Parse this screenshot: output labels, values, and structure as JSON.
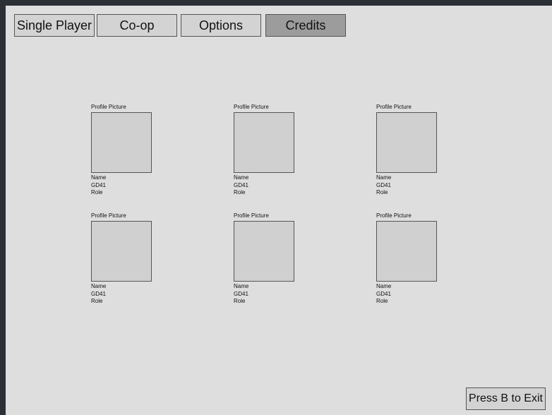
{
  "tabs": [
    {
      "label": "Single Player",
      "active": false
    },
    {
      "label": "Co-op",
      "active": false
    },
    {
      "label": "Options",
      "active": false
    },
    {
      "label": "Credits",
      "active": true
    }
  ],
  "credits": [
    {
      "caption": "Profile Picture",
      "name": "Name",
      "id": "GD41",
      "role": "Role"
    },
    {
      "caption": "Profile Picture",
      "name": "Name",
      "id": "GD41",
      "role": "Role"
    },
    {
      "caption": "Profile Picture",
      "name": "Name",
      "id": "GD41",
      "role": "Role"
    },
    {
      "caption": "Profile Picture",
      "name": "Name",
      "id": "GD41",
      "role": "Role"
    },
    {
      "caption": "Profile Picture",
      "name": "Name",
      "id": "GD41",
      "role": "Role"
    },
    {
      "caption": "Profile Picture",
      "name": "Name",
      "id": "GD41",
      "role": "Role"
    }
  ],
  "exit_button": {
    "label": "Press B to Exit"
  },
  "colors": {
    "background": "#dedede",
    "frame": "#2b2f36",
    "tab": "#d3d3d3",
    "tab_active": "#9c9c9c",
    "photo": "#d0d0d0",
    "border": "#555555"
  }
}
